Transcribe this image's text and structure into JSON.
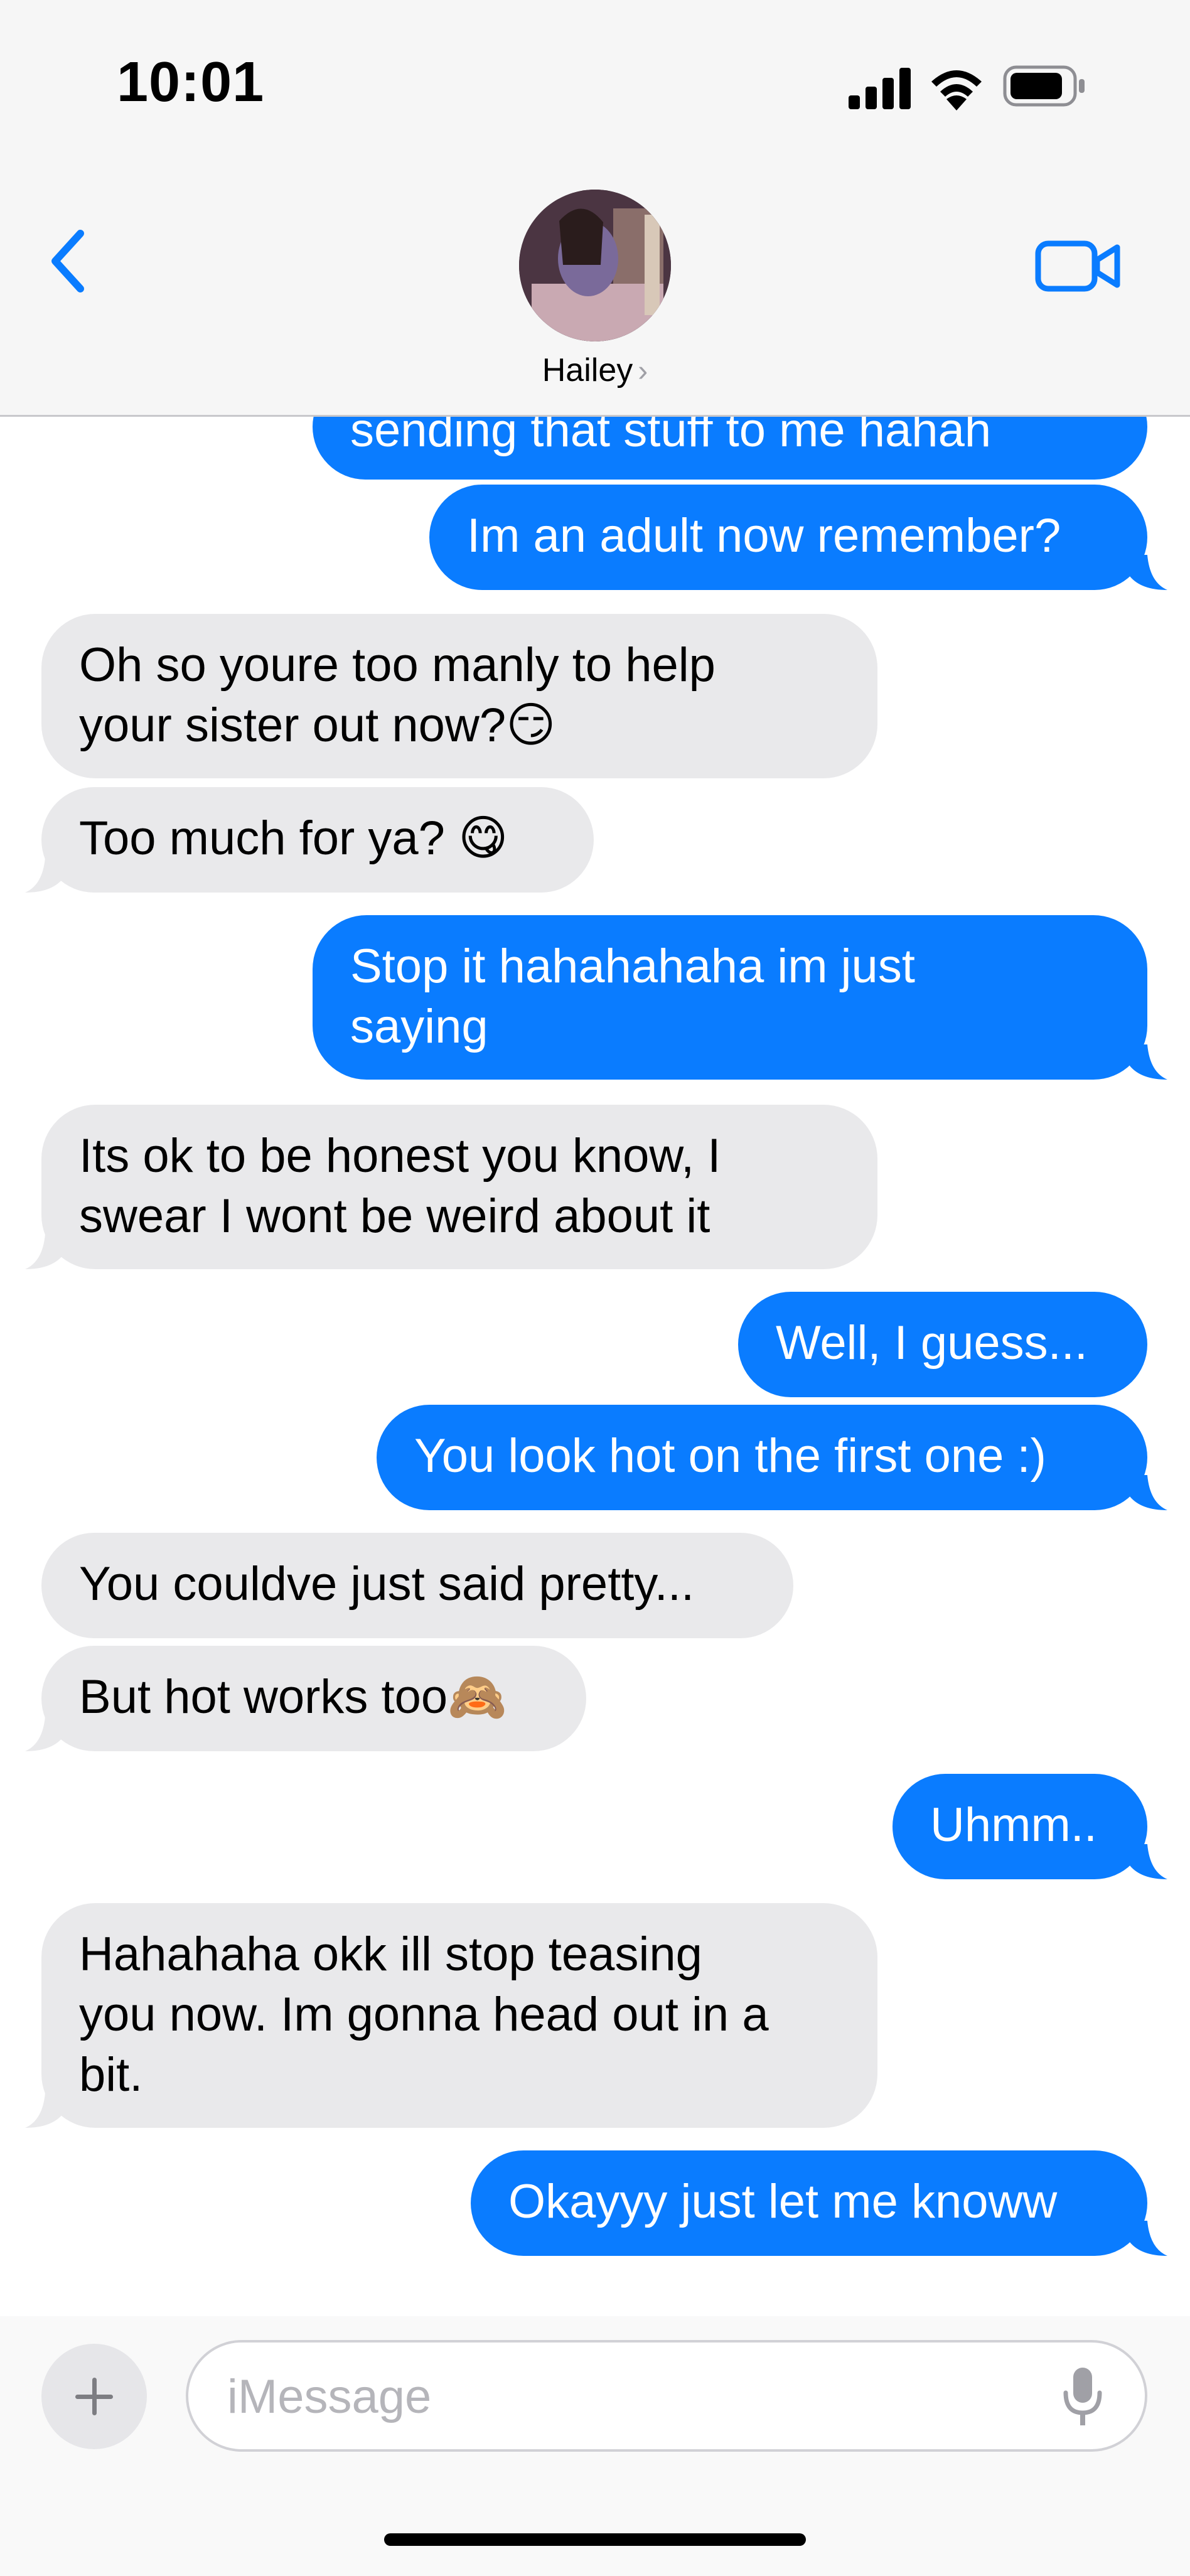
{
  "status_bar": {
    "time": "10:01"
  },
  "header": {
    "contact_name": "Hailey",
    "chevron": "›",
    "icons": [
      "back-chevron-icon",
      "avatar",
      "video-camera-icon"
    ]
  },
  "colors": {
    "outgoing_bubble": "#0a7cff",
    "incoming_bubble": "#e9e9eb",
    "accent": "#0a7cff"
  },
  "messages": [
    {
      "dir": "out",
      "text": "sending that stuff to me hahah"
    },
    {
      "dir": "out",
      "text": "Im an adult now remember?"
    },
    {
      "dir": "in",
      "lines": [
        "Oh so youre too manly to help",
        "your sister out now?😏"
      ]
    },
    {
      "dir": "in",
      "text": "Too much for ya? 😋"
    },
    {
      "dir": "out",
      "lines": [
        "Stop it hahahahaha im just",
        "saying"
      ]
    },
    {
      "dir": "in",
      "lines": [
        "Its ok to be honest you know, I",
        "swear I wont be weird about it"
      ]
    },
    {
      "dir": "out",
      "text": "Well, I guess..."
    },
    {
      "dir": "out",
      "text": "You look hot on the first one :)"
    },
    {
      "dir": "in",
      "text": "You couldve just said pretty..."
    },
    {
      "dir": "in",
      "text": "But hot works too🙈"
    },
    {
      "dir": "out",
      "text": "Uhmm.."
    },
    {
      "dir": "in",
      "lines": [
        "Hahahaha okk ill stop teasing",
        "you now. Im gonna head out in a",
        "bit."
      ]
    },
    {
      "dir": "out",
      "text": "Okayyy just let me knoww"
    }
  ],
  "input": {
    "placeholder": "iMessage"
  }
}
